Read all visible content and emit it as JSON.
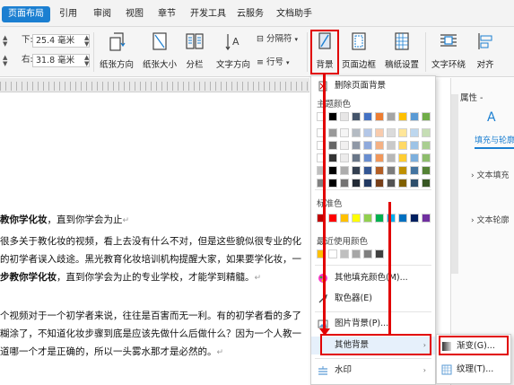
{
  "tabs": [
    {
      "label": "页面布局",
      "active": true
    },
    {
      "label": "引用"
    },
    {
      "label": "审阅"
    },
    {
      "label": "视图"
    },
    {
      "label": "章节"
    },
    {
      "label": "开发工具"
    },
    {
      "label": "云服务"
    },
    {
      "label": "文档助手"
    }
  ],
  "ribbon": {
    "margin_down_label": "下:",
    "margin_down_value": "25.4 毫米",
    "margin_right_label": "右:",
    "margin_right_value": "31.8 毫米",
    "orientation": "纸张方向",
    "paper_size": "纸张大小",
    "columns": "分栏",
    "text_direction": "文字方向",
    "line_number": "行号",
    "separator": "分隔符",
    "background": "背景",
    "page_border": "页面边框",
    "paper_setup": "稿纸设置",
    "text_wrap": "文字环绕",
    "align": "对齐"
  },
  "document": {
    "lines": [
      {
        "bold": "教你学化妆",
        "text": "，直到你学会为止"
      },
      {
        "text": "很多关于教化妆的视频，看上去没有什么不对，但是这些貌似很专业的化"
      },
      {
        "text": "的初学者误入歧途。黑光教育化妆培训机构提醒大家，如果要学化妆，一"
      },
      {
        "bold": "步教你学化妆",
        "text": "，直到你学会为止的专业学校，才能学到精髓。"
      },
      {
        "text": "个视频对于一个初学者来说，往往是百害而无一利。有的初学者看的多了"
      },
      {
        "text": "糊涂了，不知道化妆步骤到底是应该先做什么后做什么？因为一个人教一"
      },
      {
        "text": "道哪一个才是正确的，所以一头雾水那才是必然的。"
      }
    ],
    "paragraph_mark": "↵"
  },
  "menu": {
    "remove_background": "删除页面背景",
    "theme_colors": "主题颜色",
    "standard_colors": "标准色",
    "recent_colors": "最近使用颜色",
    "more_fill_colors": "其他填充颜色(M)...",
    "eyedropper": "取色器(E)",
    "picture_background": "图片背景(P)...",
    "other_background": "其他背景",
    "watermark": "水印"
  },
  "submenu": {
    "gradient": "渐变(G)...",
    "texture": "纹理(T)..."
  },
  "right_panel": {
    "properties": "属性 -",
    "fill_tab": "填充与轮廓",
    "text_fill": "文本填充",
    "text_outline": "文本轮廓"
  },
  "colors": {
    "accent": "#1b7fd1",
    "highlight": "#e10000",
    "theme_row1": [
      "#ffffff",
      "#000000",
      "#e7e6e6",
      "#44546a",
      "#4472c4",
      "#ed7d31",
      "#a5a5a5",
      "#ffc000",
      "#5b9bd5",
      "#70ad47"
    ],
    "standard": [
      "#c00000",
      "#ff0000",
      "#ffc000",
      "#ffff00",
      "#92d050",
      "#00b050",
      "#00b0f0",
      "#0070c0",
      "#002060",
      "#7030a0"
    ],
    "recent": [
      "#ffc000",
      "#ffffff",
      "#bfbfbf",
      "#a6a6a6",
      "#7f7f7f",
      "#404040"
    ]
  }
}
